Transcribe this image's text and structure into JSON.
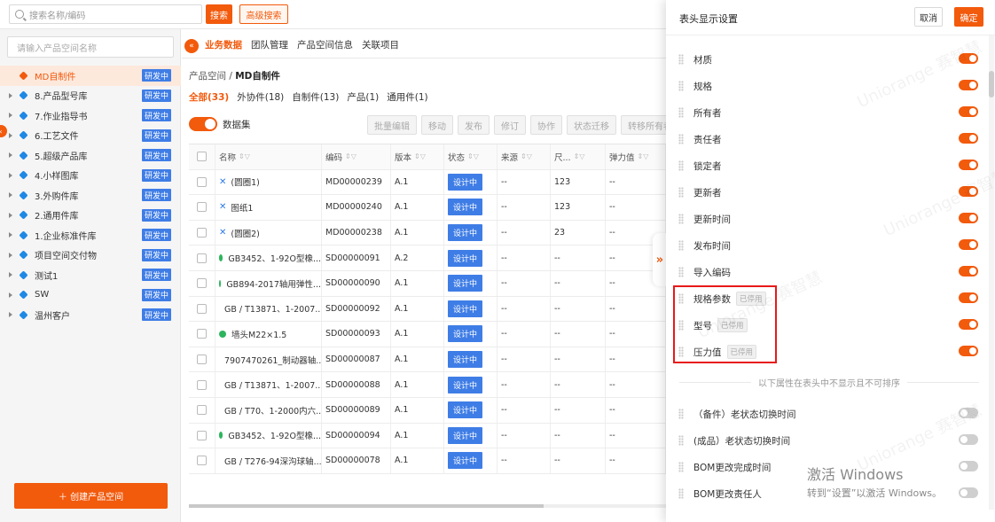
{
  "topbar": {
    "search_placeholder": "搜索名称/编码",
    "search_btn": "搜索",
    "adv_btn": "高级搜索"
  },
  "sidebar": {
    "search_placeholder": "请输入产品空间名称",
    "items": [
      {
        "label": "MD自制件",
        "badge": "研发中",
        "active": true,
        "has_caret": false
      },
      {
        "label": "8.产品型号库",
        "badge": "研发中",
        "active": false,
        "has_caret": true
      },
      {
        "label": "7.作业指导书",
        "badge": "研发中",
        "active": false,
        "has_caret": true
      },
      {
        "label": "6.工艺文件",
        "badge": "研发中",
        "active": false,
        "has_caret": true
      },
      {
        "label": "5.超级产品库",
        "badge": "研发中",
        "active": false,
        "has_caret": true
      },
      {
        "label": "4.小样图库",
        "badge": "研发中",
        "active": false,
        "has_caret": true
      },
      {
        "label": "3.外购件库",
        "badge": "研发中",
        "active": false,
        "has_caret": true
      },
      {
        "label": "2.通用件库",
        "badge": "研发中",
        "active": false,
        "has_caret": true
      },
      {
        "label": "1.企业标准件库",
        "badge": "研发中",
        "active": false,
        "has_caret": true
      },
      {
        "label": "项目空间交付物",
        "badge": "研发中",
        "active": false,
        "has_caret": true
      },
      {
        "label": "测试1",
        "badge": "研发中",
        "active": false,
        "has_caret": true
      },
      {
        "label": "SW",
        "badge": "研发中",
        "active": false,
        "has_caret": true
      },
      {
        "label": "温州客户",
        "badge": "研发中",
        "active": false,
        "has_caret": true
      }
    ],
    "create_btn": "＋  创建产品空间"
  },
  "main": {
    "nav_tabs": [
      "业务数据",
      "团队管理",
      "产品空间信息",
      "关联项目"
    ],
    "crumb_prefix": "产品空间 / ",
    "crumb_current": "MD自制件",
    "sub_tabs": [
      "全部(33)",
      "外协件(18)",
      "自制件(13)",
      "产品(1)",
      "通用件(1)"
    ],
    "toggle_label": "数据集",
    "toolbar": [
      "批量编辑",
      "移动",
      "发布",
      "修订",
      "协作",
      "状态迁移",
      "转移所有者"
    ],
    "table_headers": [
      "名称",
      "编码",
      "版本",
      "状态",
      "来源",
      "尺...",
      "弹力值"
    ],
    "rows": [
      {
        "icon": "x",
        "name": "(圆圈1)",
        "code": "MD00000239",
        "ver": "A.1",
        "status": "设计中",
        "src": "--",
        "size": "123",
        "elastic": "--"
      },
      {
        "icon": "x",
        "name": "图纸1",
        "code": "MD00000240",
        "ver": "A.1",
        "status": "设计中",
        "src": "--",
        "size": "123",
        "elastic": "--"
      },
      {
        "icon": "x",
        "name": "(圆圈2)",
        "code": "MD00000238",
        "ver": "A.1",
        "status": "设计中",
        "src": "--",
        "size": "23",
        "elastic": "--"
      },
      {
        "icon": "g",
        "name": "GB3452、1-92O型橡...",
        "code": "SD00000091",
        "ver": "A.2",
        "status": "设计中",
        "src": "--",
        "size": "--",
        "elastic": "--"
      },
      {
        "icon": "g",
        "name": "GB894-2017轴用弹性...",
        "code": "SD00000090",
        "ver": "A.1",
        "status": "设计中",
        "src": "--",
        "size": "--",
        "elastic": "--"
      },
      {
        "icon": "g",
        "name": "GB / T13871、1-2007...",
        "code": "SD00000092",
        "ver": "A.1",
        "status": "设计中",
        "src": "--",
        "size": "--",
        "elastic": "--"
      },
      {
        "icon": "g",
        "name": "墙头M22×1.5",
        "code": "SD00000093",
        "ver": "A.1",
        "status": "设计中",
        "src": "--",
        "size": "--",
        "elastic": "--"
      },
      {
        "icon": "g",
        "name": "7907470261_制动器轴...",
        "code": "SD00000087",
        "ver": "A.1",
        "status": "设计中",
        "src": "--",
        "size": "--",
        "elastic": "--"
      },
      {
        "icon": "g",
        "name": "GB / T13871、1-2007...",
        "code": "SD00000088",
        "ver": "A.1",
        "status": "设计中",
        "src": "--",
        "size": "--",
        "elastic": "--"
      },
      {
        "icon": "g",
        "name": "GB / T70、1-2000内六...",
        "code": "SD00000089",
        "ver": "A.1",
        "status": "设计中",
        "src": "--",
        "size": "--",
        "elastic": "--"
      },
      {
        "icon": "g",
        "name": "GB3452、1-92O型橡...",
        "code": "SD00000094",
        "ver": "A.1",
        "status": "设计中",
        "src": "--",
        "size": "--",
        "elastic": "--"
      },
      {
        "icon": "g",
        "name": "GB / T276-94深沟球轴...",
        "code": "SD00000078",
        "ver": "A.1",
        "status": "设计中",
        "src": "--",
        "size": "--",
        "elastic": "--"
      }
    ]
  },
  "panel": {
    "title": "表头显示设置",
    "cancel": "取消",
    "ok": "确定",
    "shown_attrs": [
      {
        "name": "材质",
        "on": true,
        "disabled_tag": ""
      },
      {
        "name": "规格",
        "on": true,
        "disabled_tag": ""
      },
      {
        "name": "所有者",
        "on": true,
        "disabled_tag": ""
      },
      {
        "name": "责任者",
        "on": true,
        "disabled_tag": ""
      },
      {
        "name": "锁定者",
        "on": true,
        "disabled_tag": ""
      },
      {
        "name": "更新者",
        "on": true,
        "disabled_tag": ""
      },
      {
        "name": "更新时间",
        "on": true,
        "disabled_tag": ""
      },
      {
        "name": "发布时间",
        "on": true,
        "disabled_tag": ""
      },
      {
        "name": "导入编码",
        "on": true,
        "disabled_tag": ""
      },
      {
        "name": "规格参数",
        "on": true,
        "disabled_tag": "已停用"
      },
      {
        "name": "型号",
        "on": true,
        "disabled_tag": "已停用"
      },
      {
        "name": "压力值",
        "on": true,
        "disabled_tag": "已停用"
      }
    ],
    "divider": "以下属性在表头中不显示且不可排序",
    "hidden_attrs": [
      {
        "name": "（备件）老状态切换时间",
        "on": false
      },
      {
        "name": "(成品）老状态切换时间",
        "on": false
      },
      {
        "name": "BOM更改完成时间",
        "on": false
      },
      {
        "name": "BOM更改责任人",
        "on": false
      }
    ]
  },
  "watermark": "Uniorange 赛智慧",
  "windows": {
    "line1": "激活 Windows",
    "line2": "转到“设置”以激活 Windows。"
  }
}
